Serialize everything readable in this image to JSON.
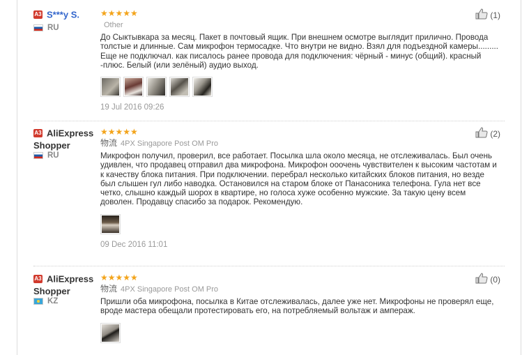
{
  "reviews": [
    {
      "badge": "A3",
      "user_name": "S***y S.",
      "user_name_line2": "",
      "country": "RU",
      "flag": "ru",
      "stars": "★★★★★",
      "shipping_label": "",
      "shipping_method": "Other",
      "text": "До Сыктывкара за месяц. Пакет в почтовый ящик. При внешнем осмотре выглядит прилично. Провода толстые и длинные. Сам микрофон термосадке. Что внутри не видно. Взял для подъездной камеры......... Еще не подключал. как писалось ранее провода для подключения: чёрный - минус (общий). красный -плюс. Белый (или зелёный) аудио выход.",
      "thumbnail_count": 5,
      "date": "19 Jul 2016 09:26",
      "helpful_count": "(1)"
    },
    {
      "badge": "A3",
      "user_name": "AliExpress",
      "user_name_line2": "Shopper",
      "country": "RU",
      "flag": "ru",
      "stars": "★★★★★",
      "shipping_label": "物流",
      "shipping_method": "4PX Singapore Post OM Pro",
      "text": "Микрофон получил, проверил, все работает. Посылка шла около месяца, не отслеживалась. Был очень удивлен, что продавец отправил два микрофона. Микрофон ооочень чувствителен к высоким частотам и к качеству блока питания. При подключении. перебрал несколько китайских блоков питания, но везде был слышен гул либо наводка. Остановился на старом блоке от Панасоника телефона. Гула нет все четко, слышно каждый шорох в квартире, но голоса хуже особенно мужские. За такую цену всем доволен. Продавцу спасибо за подарок. Рекомендую.",
      "thumbnail_count": 1,
      "date": "09 Dec 2016 11:01",
      "helpful_count": "(2)"
    },
    {
      "badge": "A3",
      "user_name": "AliExpress",
      "user_name_line2": "Shopper",
      "country": "KZ",
      "flag": "kz",
      "stars": "★★★★★",
      "shipping_label": "物流",
      "shipping_method": "4PX Singapore Post OM Pro",
      "text": "Пришли оба микрофона, посылка в Китае отслеживалась, далее уже нет. Микрофоны не проверял еще, вроде мастера обещали протестировать его, на потребляемый вольтаж и ампераж.",
      "thumbnail_count": 1,
      "date": "",
      "helpful_count": "(0)"
    }
  ],
  "colors": {
    "star": "#f3a41b",
    "badge": "#d13a2d",
    "link": "#3366cc"
  }
}
